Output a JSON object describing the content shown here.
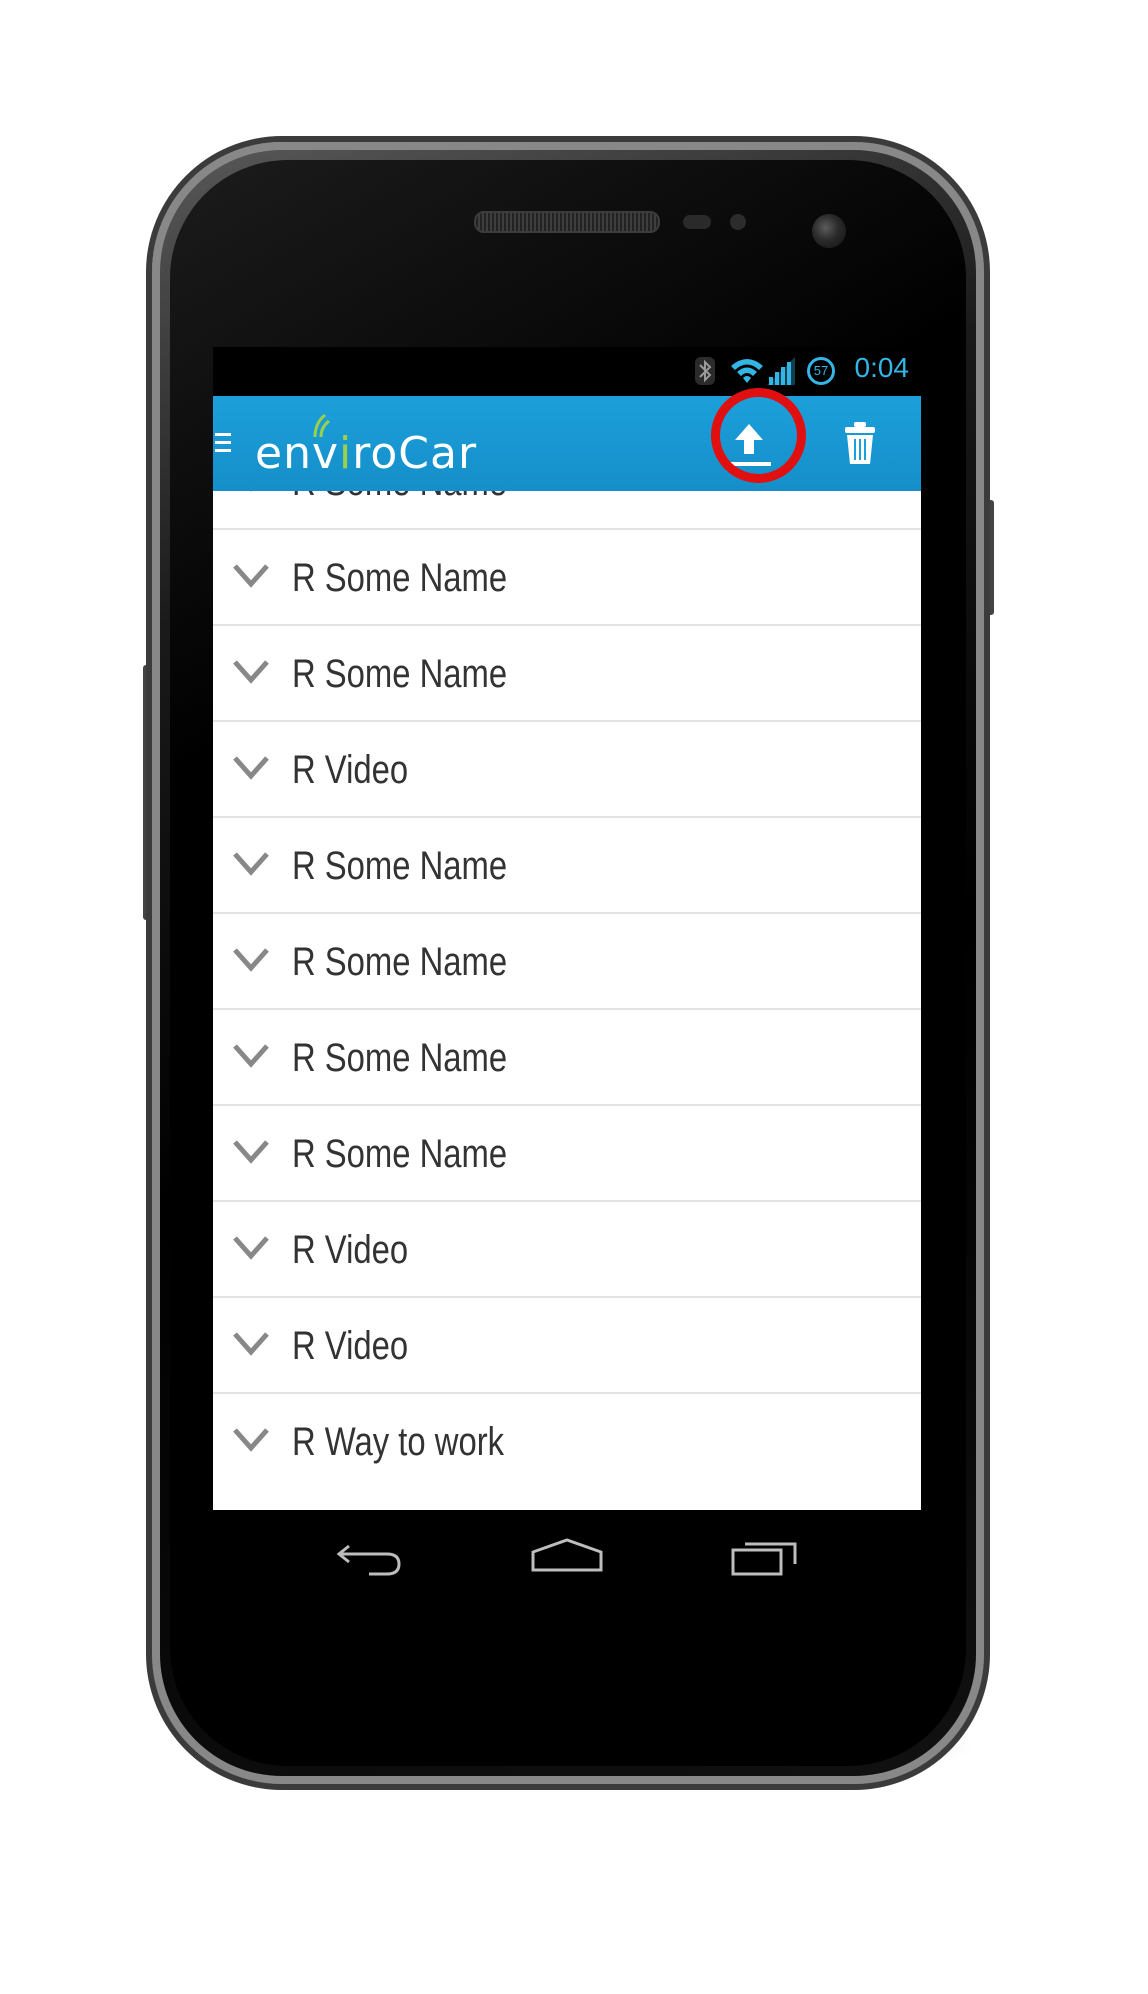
{
  "status_bar": {
    "time": "0:04",
    "battery_level": "57",
    "icons": [
      "bluetooth-icon",
      "wifi-icon",
      "signal-icon",
      "battery-icon"
    ]
  },
  "action_bar": {
    "logo_prefix": "env",
    "logo_accent": "i",
    "logo_suffix": "roCar",
    "actions": [
      "upload-icon",
      "trash-icon"
    ],
    "colors": {
      "bar": "#1ca0da",
      "accent": "#9bd14a",
      "highlight": "#e01010"
    }
  },
  "tracks": [
    {
      "label": "R Some Name"
    },
    {
      "label": "R Some Name"
    },
    {
      "label": "R Some Name"
    },
    {
      "label": "R Video"
    },
    {
      "label": "R Some Name"
    },
    {
      "label": "R Some Name"
    },
    {
      "label": "R Some Name"
    },
    {
      "label": "R Some Name"
    },
    {
      "label": "R Video"
    },
    {
      "label": "R Video"
    },
    {
      "label": "R Way to work"
    }
  ],
  "nav_bar": {
    "icons": [
      "back-icon",
      "home-icon",
      "recent-apps-icon"
    ]
  }
}
